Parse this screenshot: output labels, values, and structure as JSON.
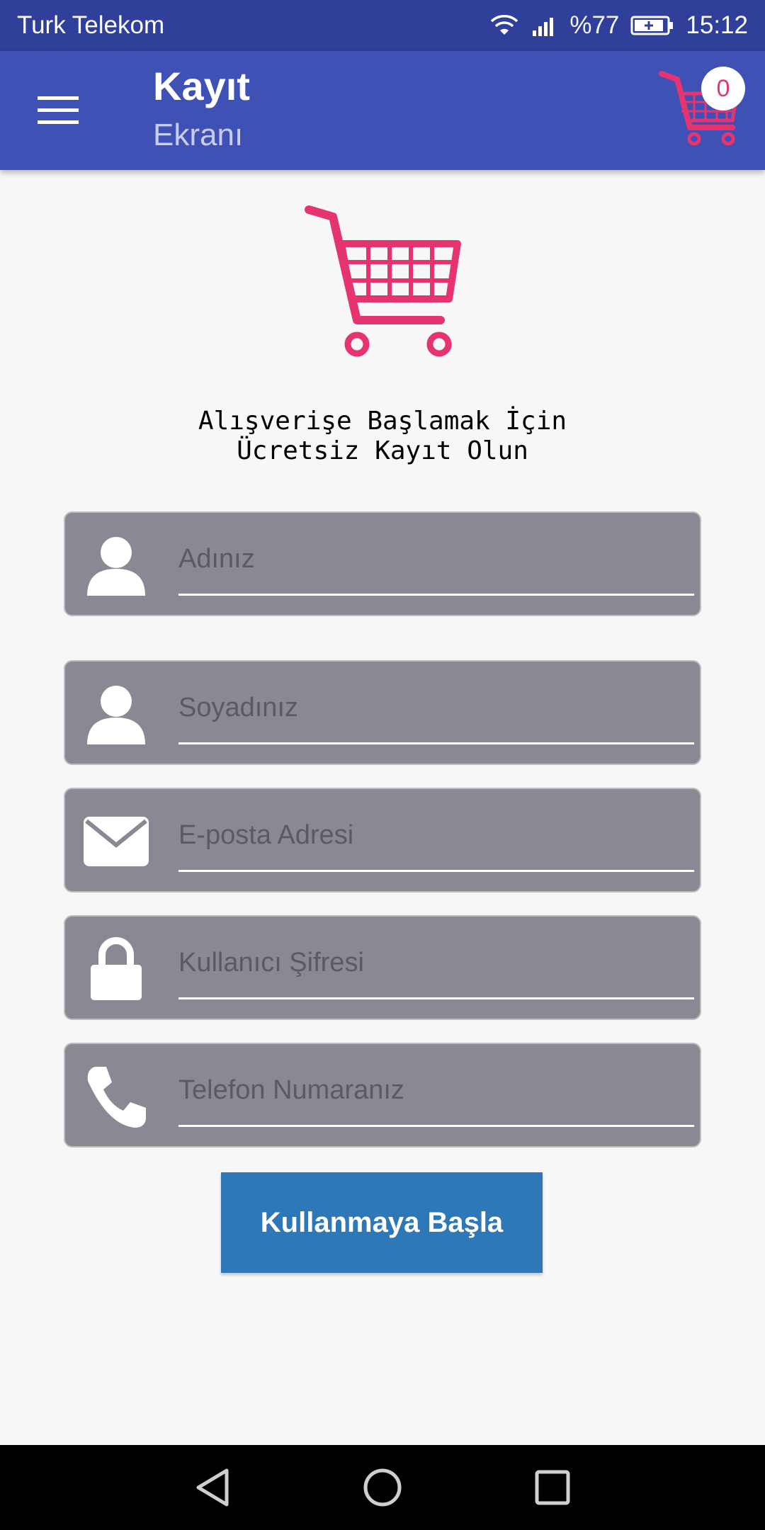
{
  "status_bar": {
    "carrier": "Turk Telekom",
    "battery": "%77",
    "time": "15:12",
    "icons": [
      "wifi-icon",
      "signal-icon",
      "battery-icon"
    ]
  },
  "app_bar": {
    "title": "Kayıt",
    "subtitle": "Ekranı",
    "cart_count": "0",
    "icons": [
      "menu-icon",
      "cart-icon"
    ]
  },
  "main": {
    "headline_line1": "Alışverişe Başlamak İçin",
    "headline_line2": "Ücretsiz Kayıt Olun",
    "fields": [
      {
        "placeholder": "Adınız",
        "icon": "person-icon"
      },
      {
        "placeholder": "Soyadınız",
        "icon": "person-icon"
      },
      {
        "placeholder": "E-posta Adresi",
        "icon": "envelope-icon"
      },
      {
        "placeholder": "Kullanıcı Şifresi",
        "icon": "lock-icon"
      },
      {
        "placeholder": "Telefon Numaranız",
        "icon": "phone-icon"
      }
    ],
    "submit_label": "Kullanmaya Başla"
  },
  "nav_bar": {
    "icons": [
      "back-icon",
      "home-icon",
      "recents-icon"
    ]
  },
  "colors": {
    "primary": "#3f51b5",
    "primary_dark": "#2f3f9a",
    "accent": "#e53470",
    "field_bg": "#8a8893",
    "button": "#2f78b7"
  }
}
